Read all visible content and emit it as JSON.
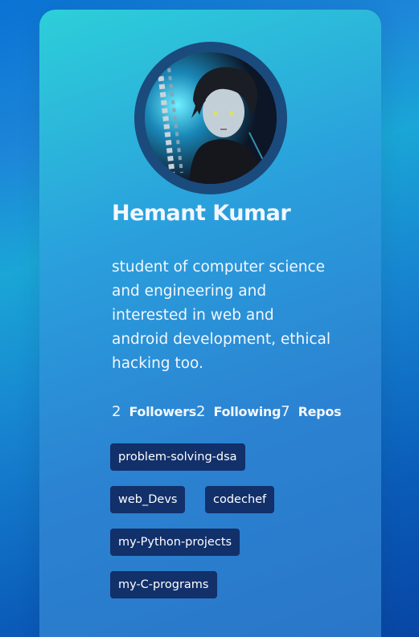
{
  "profile": {
    "name": "Hemant Kumar",
    "bio": "student of computer science and engineering and interested in web and android development, ethical hacking too.",
    "avatar_icon": "anime-avatar-icon"
  },
  "stats": {
    "followers_count": "2",
    "followers_label": "Followers",
    "following_count": "2",
    "following_label": "Following",
    "repos_count": "7",
    "repos_label": "Repos"
  },
  "repos": [
    "problem-solving-dsa",
    "web_Devs",
    "codechef",
    "my-Python-projects",
    "my-C-programs"
  ],
  "colors": {
    "tag_background": "#12306a",
    "avatar_ring": "#1b4a7d",
    "text": "#f2f7ff"
  }
}
